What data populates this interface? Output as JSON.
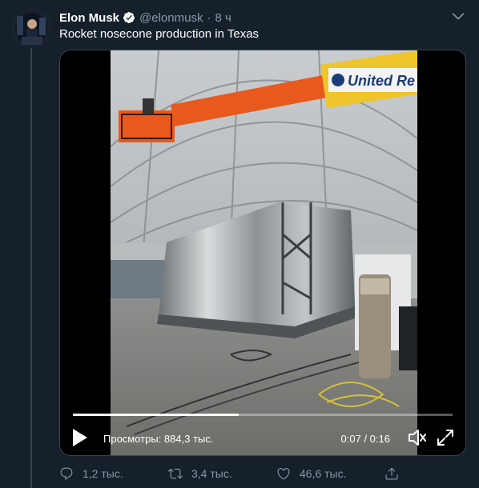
{
  "tweet": {
    "author_name": "Elon Musk",
    "author_handle": "@elonmusk",
    "separator": "·",
    "time": "8 ч",
    "text": "Rocket nosecone production in Texas"
  },
  "video": {
    "views_label": "Просмотры: 884,3 тыс.",
    "timecode": "0:07 / 0:16",
    "progress": 0.4375,
    "sign_text": "United Re"
  },
  "actions": {
    "reply_count": "1,2 тыс.",
    "retweet_count": "3,4 тыс.",
    "like_count": "46,6 тыс."
  },
  "colors": {
    "background": "#15202b",
    "secondary_text": "#8899a6",
    "verified_blue": "#1da1f2",
    "boom_orange": "#e8591e"
  }
}
